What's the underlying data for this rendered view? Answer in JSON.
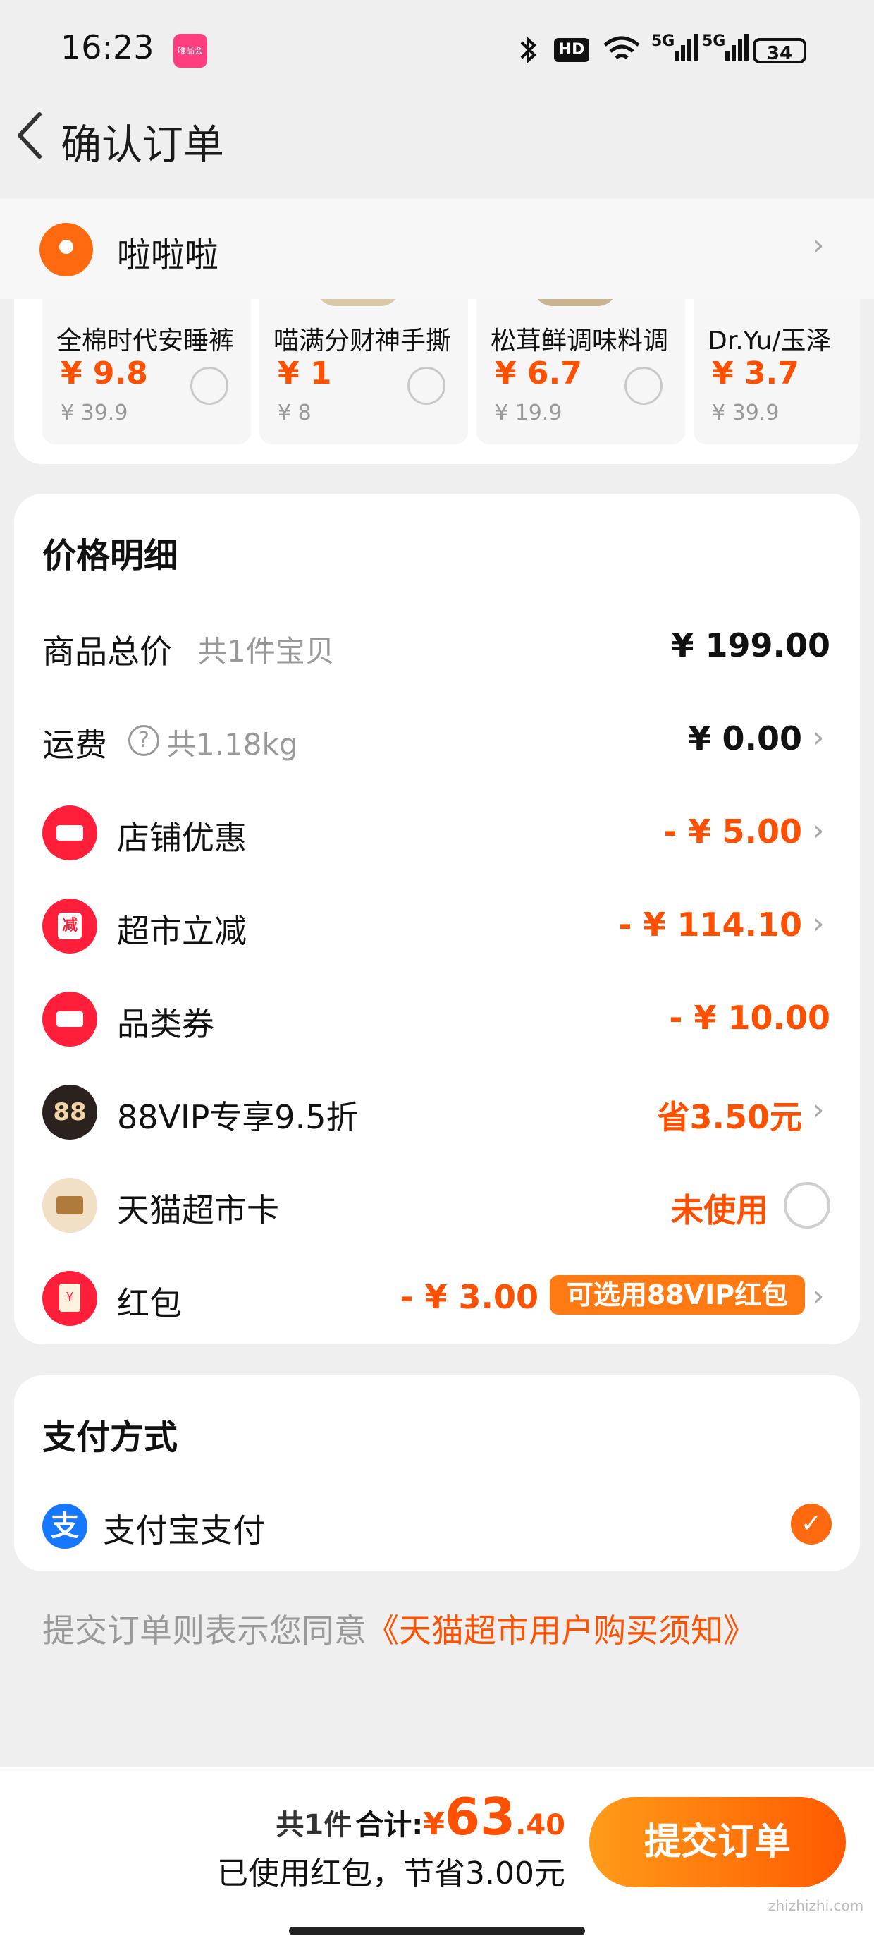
{
  "status_bar": {
    "time": "16:23",
    "app_badge": "唯品会",
    "network_1": "5G",
    "network_2": "5G",
    "hd": "HD",
    "battery": "34"
  },
  "header": {
    "title": "确认订单"
  },
  "address": {
    "name": "啦啦啦"
  },
  "recommended": [
    {
      "name": "全棉时代安睡裤",
      "price": "¥ 9.8",
      "original": "¥ 39.9"
    },
    {
      "name": "喵满分财神手撕",
      "price": "¥ 1",
      "original": "¥ 8"
    },
    {
      "name": "松茸鲜调味料调",
      "price": "¥ 6.7",
      "original": "¥ 19.9"
    },
    {
      "name": "Dr.Yu/玉泽",
      "price": "¥ 3.7",
      "original": "¥ 39.9"
    }
  ],
  "price_detail": {
    "title": "价格明细",
    "goods_total": {
      "label": "商品总价",
      "sub": "共1件宝贝",
      "value": "¥ 199.00"
    },
    "shipping": {
      "label": "运费",
      "sub": "共1.18kg",
      "value": "¥ 0.00"
    },
    "shop_discount": {
      "label": "店铺优惠",
      "value": "- ¥ 5.00"
    },
    "market_cut": {
      "label": "超市立减",
      "value": "- ¥ 114.10"
    },
    "category_coupon": {
      "label": "品类券",
      "value": "- ¥ 10.00"
    },
    "vip": {
      "label": "88VIP专享9.5折",
      "value": "省3.50元",
      "icon_text": "88"
    },
    "market_card": {
      "label": "天猫超市卡",
      "value": "未使用"
    },
    "red_packet": {
      "label": "红包",
      "value": "- ¥ 3.00",
      "tag": "可选用88VIP红包"
    }
  },
  "payment": {
    "title": "支付方式",
    "method": "支付宝支付",
    "icon_text": "支"
  },
  "agreement": {
    "prefix": "提交订单则表示您同意",
    "link": "《天猫超市用户购买须知》"
  },
  "bottom_bar": {
    "count": "共1件",
    "total_label": "合计:",
    "currency": "¥",
    "total_int": "63",
    "total_dec": ".40",
    "saved_note": "已使用红包，节省3.00元",
    "submit": "提交订单"
  },
  "watermark": "zhizhizhi.com",
  "colors": {
    "accent": "#ff5000",
    "brand_red": "#ff1f3a",
    "alipay": "#1677ff"
  }
}
